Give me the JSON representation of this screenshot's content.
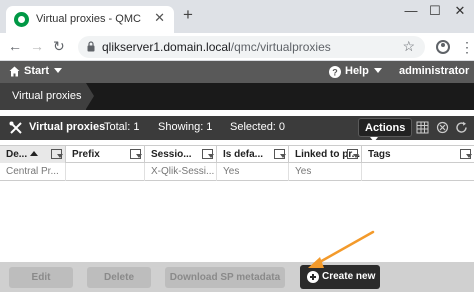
{
  "browser": {
    "tab_title": "Virtual proxies - QMC",
    "tab_close": "✕",
    "new_tab": "+",
    "window_controls": {
      "minimize": "—",
      "maximize": "☐",
      "close": "✕"
    },
    "url_host": "qlikserver1.domain.local",
    "url_path": "/qmc/virtualproxies",
    "nav": {
      "back": "←",
      "forward": "→",
      "reload": "↻"
    },
    "star": "☆",
    "menu": "⋮"
  },
  "header": {
    "start_label": "Start",
    "help_label": "Help",
    "user_label": "administrator"
  },
  "breadcrumb": {
    "current": "Virtual proxies"
  },
  "toolbar": {
    "title": "Virtual proxies",
    "total": "Total: 1",
    "showing": "Showing: 1",
    "selected": "Selected: 0",
    "actions_label": "Actions"
  },
  "table": {
    "columns": [
      "De...",
      "Prefix",
      "Sessio...",
      "Is defa...",
      "Linked to pr...",
      "Tags"
    ],
    "rows": [
      [
        "Central Pr...",
        "",
        "X-Qlik-Sessi...",
        "Yes",
        "Yes",
        ""
      ]
    ]
  },
  "footer": {
    "edit_label": "Edit",
    "delete_label": "Delete",
    "download_label": "Download SP metadata",
    "create_label": "Create new"
  },
  "colors": {
    "qlik_green": "#009845",
    "annotation_arrow": "#f39a2b"
  }
}
